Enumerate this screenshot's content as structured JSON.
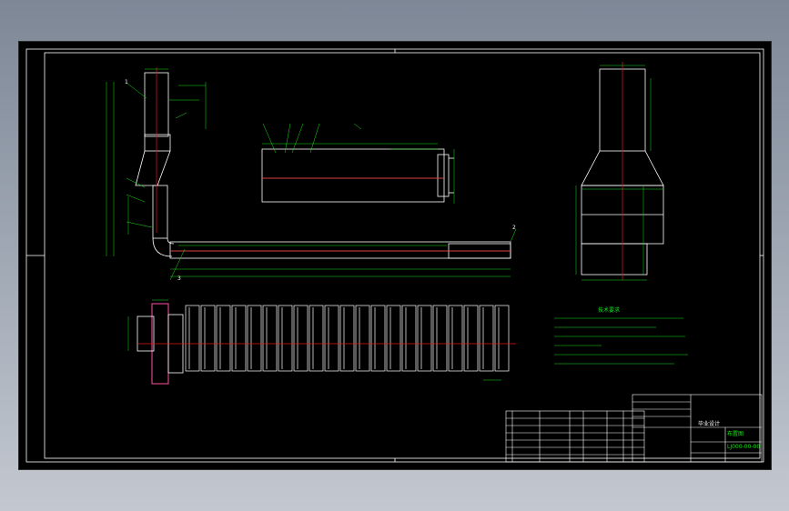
{
  "drawing": {
    "part_labels": {
      "left_column": "1",
      "nozzle_tip": "3",
      "long_duct_end": "2"
    },
    "notes_title": "技术要求",
    "title_block": {
      "name": "布置图",
      "drawing_number": "LJ000-00-00",
      "company": "毕业设计"
    }
  },
  "colors": {
    "background": "#000000",
    "outline": "#ffffff",
    "dimension": "#18e018",
    "centerline": "#e01818",
    "border_pink": "#ff4fa0"
  }
}
